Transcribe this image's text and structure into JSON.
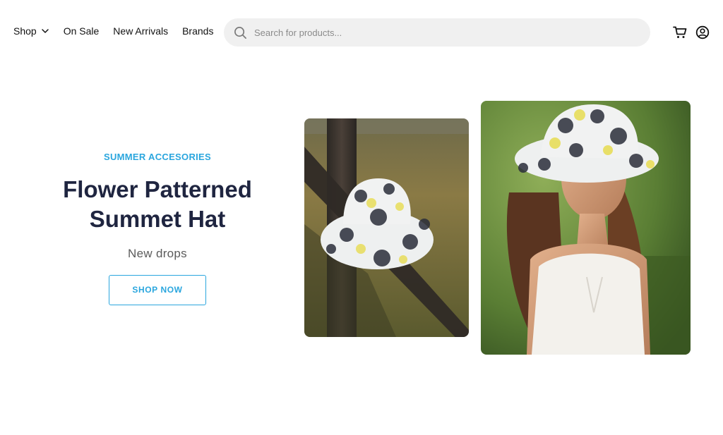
{
  "nav": {
    "items": [
      {
        "label": "Shop",
        "has_dropdown": true
      },
      {
        "label": "On Sale"
      },
      {
        "label": "New Arrivals"
      },
      {
        "label": "Brands"
      }
    ]
  },
  "search": {
    "placeholder": "Search for products...",
    "value": ""
  },
  "header_icons": {
    "cart": "cart-icon",
    "user": "user-circle-icon"
  },
  "hero": {
    "eyebrow": "SUMMER ACCESORIES",
    "title_line1": "Flower Patterned",
    "title_line2": "Summet Hat",
    "subtitle": "New drops",
    "cta_label": "SHOP NOW"
  },
  "colors": {
    "accent": "#2aa6de",
    "title": "#1f2540",
    "search_bg": "#f0f0f0"
  }
}
